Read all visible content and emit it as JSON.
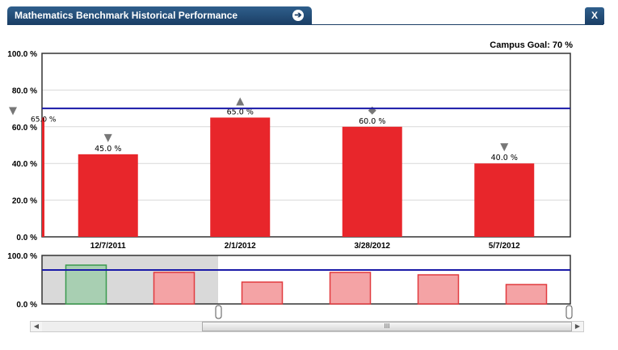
{
  "window": {
    "title": "Mathematics Benchmark Historical Performance",
    "go_glyph": "➔",
    "close_label": "X"
  },
  "goal_label": "Campus Goal: 70 %",
  "colors": {
    "bar": "#e8262b",
    "goal_line": "#1a1aa8",
    "nav_selected_bar": "#a8cfb2",
    "nav_bar": "#f4a3a5",
    "nav_window": "#d9d9d9"
  },
  "chart_data": {
    "type": "bar",
    "title": "",
    "xlabel": "",
    "ylabel": "",
    "ylim": [
      0,
      100
    ],
    "y_ticks": [
      "0.0 %",
      "20.0 %",
      "40.0 %",
      "60.0 %",
      "80.0 %",
      "100.0 %"
    ],
    "goal": 70,
    "categories": [
      "12/7/2011",
      "2/1/2012",
      "3/28/2012",
      "5/7/2012"
    ],
    "values": [
      45,
      65,
      60,
      40
    ],
    "value_labels": [
      "45.0 %",
      "65.0 %",
      "60.0 %",
      "40.0 %"
    ],
    "trend_icons": [
      "down-triangle-icon",
      "up-triangle-icon",
      "diamond-icon",
      "down-triangle-icon"
    ],
    "partial_left": {
      "label": "65.0 %",
      "value": 65,
      "trend_icon": "down-triangle-icon"
    },
    "navigator": {
      "y_ticks": [
        "0.0 %",
        "100.0 %"
      ],
      "values": [
        80,
        65,
        45,
        65,
        60,
        40
      ],
      "selected_index": 0
    }
  },
  "scrollbar": {
    "left_arrow": "◀",
    "right_arrow": "▶",
    "thumb_grip": "III"
  }
}
